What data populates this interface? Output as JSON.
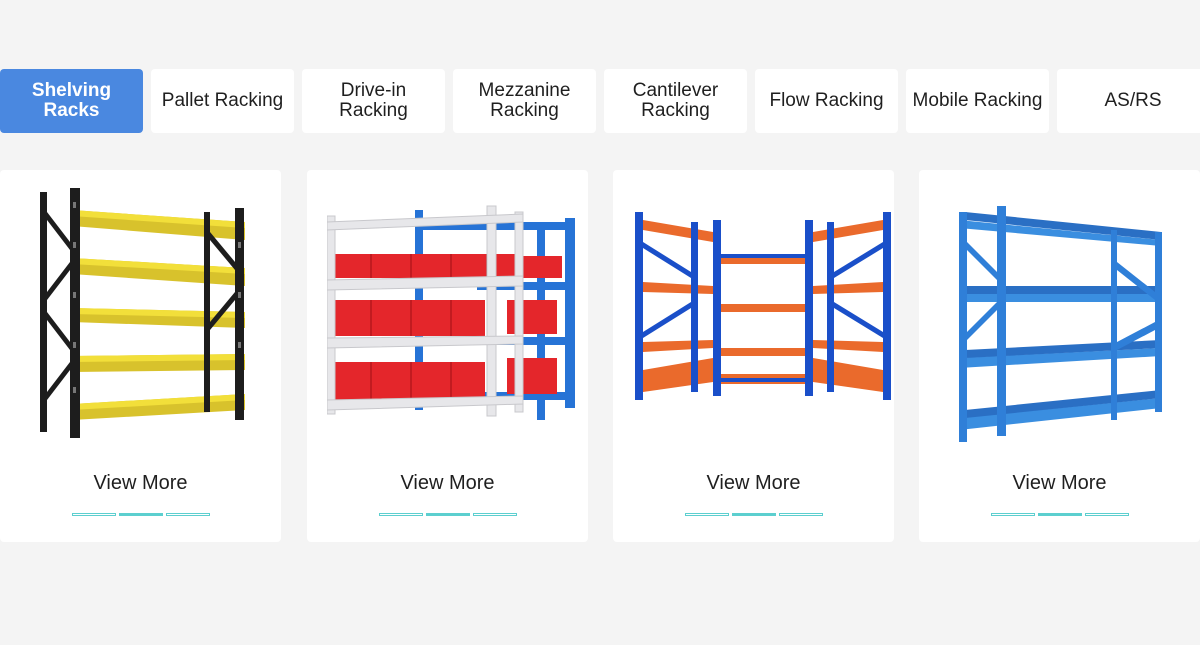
{
  "tabs": [
    {
      "label_lines": [
        "Shelving Racks"
      ],
      "active": true
    },
    {
      "label_lines": [
        "Pallet Racking"
      ],
      "active": false
    },
    {
      "label_lines": [
        "Drive-in Racking"
      ],
      "active": false
    },
    {
      "label_lines": [
        "Mezzanine",
        "Racking"
      ],
      "active": false
    },
    {
      "label_lines": [
        "Cantilever",
        "Racking"
      ],
      "active": false
    },
    {
      "label_lines": [
        "Flow Racking"
      ],
      "active": false
    },
    {
      "label_lines": [
        "Mobile Racking"
      ],
      "active": false
    },
    {
      "label_lines": [
        "AS/RS"
      ],
      "active": false
    }
  ],
  "cards": [
    {
      "image_icon": "yellow-black-shelving-rack-image",
      "more_label": "View More",
      "active_dot": 1
    },
    {
      "image_icon": "white-blue-shelving-with-red-bins-image",
      "more_label": "View More",
      "active_dot": 1
    },
    {
      "image_icon": "blue-orange-corner-shelving-image",
      "more_label": "View More",
      "active_dot": 1
    },
    {
      "image_icon": "blue-shelving-rack-image",
      "more_label": "View More",
      "active_dot": 1
    }
  ],
  "colors": {
    "active_tab": "#4a88e0",
    "indicator": "#5ccfcf"
  }
}
